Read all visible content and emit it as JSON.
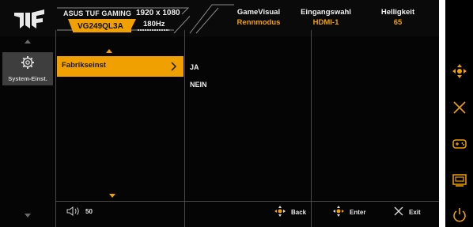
{
  "header": {
    "model_name": "ASUS TUF GAMING",
    "model_code": "VG249QL3A",
    "resolution": "1920 x 1080",
    "refresh_rate": "180Hz",
    "gamevisual_label": "GameVisual",
    "gamevisual_value": "Rennmodus",
    "input_label": "Eingangswahl",
    "input_value": "HDMI-1",
    "brightness_label": "Helligkeit",
    "brightness_value": "65"
  },
  "sidebar": {
    "items": [
      {
        "label": "System-Einst.",
        "icon": "gear-icon"
      }
    ]
  },
  "menu": {
    "items": [
      {
        "label": "Fabrikseinst"
      }
    ]
  },
  "options": [
    "JA",
    "NEIN"
  ],
  "footer": {
    "volume": "50",
    "back_label": "Back",
    "enter_label": "Enter",
    "exit_label": "Exit"
  },
  "colors": {
    "accent": "#f0a000",
    "background": "#050505",
    "selected_side": "#3e3e3e"
  },
  "right_icons": [
    "move-joystick-icon",
    "close-icon",
    "gamepad-icon",
    "input-source-icon",
    "power-icon"
  ]
}
